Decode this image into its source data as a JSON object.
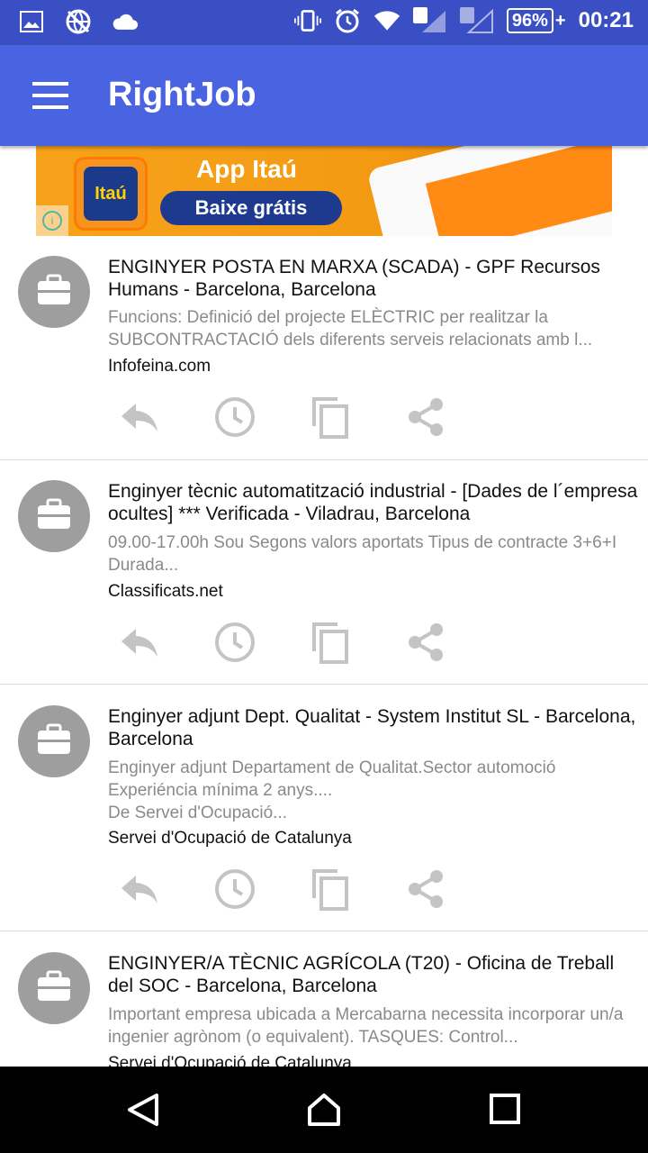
{
  "status_bar": {
    "battery": "96%",
    "battery_plus": "+",
    "time": "00:21",
    "sim1": "1",
    "sim2": "2"
  },
  "toolbar": {
    "title": "RightJob"
  },
  "ad": {
    "logo_text": "Itaú",
    "title": "App Itaú",
    "button_label": "Baixe grátis"
  },
  "jobs": [
    {
      "title": "ENGINYER POSTA EN MARXA (SCADA) - GPF Recursos Humans - Barcelona, Barcelona",
      "description": "Funcions: Definició del projecte ELÈCTRIC per realitzar la SUBCONTRACTACIÓ dels diferents serveis relacionats amb l...",
      "source": "Infofeina.com"
    },
    {
      "title": "Enginyer tècnic automatització industrial - [Dades de l´empresa ocultes] *** Verificada - Viladrau, Barcelona",
      "description": "09.00-17.00h Sou Segons valors aportats Tipus de contracte 3+6+I Durada...",
      "source": "Classificats.net"
    },
    {
      "title": "Enginyer adjunt Dept. Qualitat - System Institut SL - Barcelona, Barcelona",
      "description": "Enginyer adjunt Departament de Qualitat.Sector automoció\nExperiéncia mínima 2 anys....\nDe Servei d'Ocupació...",
      "source": "Servei d'Ocupació de Catalunya"
    },
    {
      "title": "ENGINYER/A TÈCNIC AGRÍCOLA (T20) - Oficina de Treball del SOC - Barcelona, Barcelona",
      "description": "Important empresa ubicada a Mercabarna necessita incorporar un/a ingenier agrònom (o equivalent). TASQUES: Control...",
      "source": "Servei d'Ocupació de Catalunya"
    }
  ],
  "colors": {
    "status_bar": "#3a4fc4",
    "toolbar": "#4a63e0",
    "icon_gray": "#c4c4c4",
    "avatar_gray": "#9e9e9e"
  },
  "icons": {
    "action_row": [
      "reply-icon",
      "clock-icon",
      "copy-icon",
      "share-icon"
    ],
    "nav": [
      "back-icon",
      "home-icon",
      "recents-icon"
    ]
  }
}
